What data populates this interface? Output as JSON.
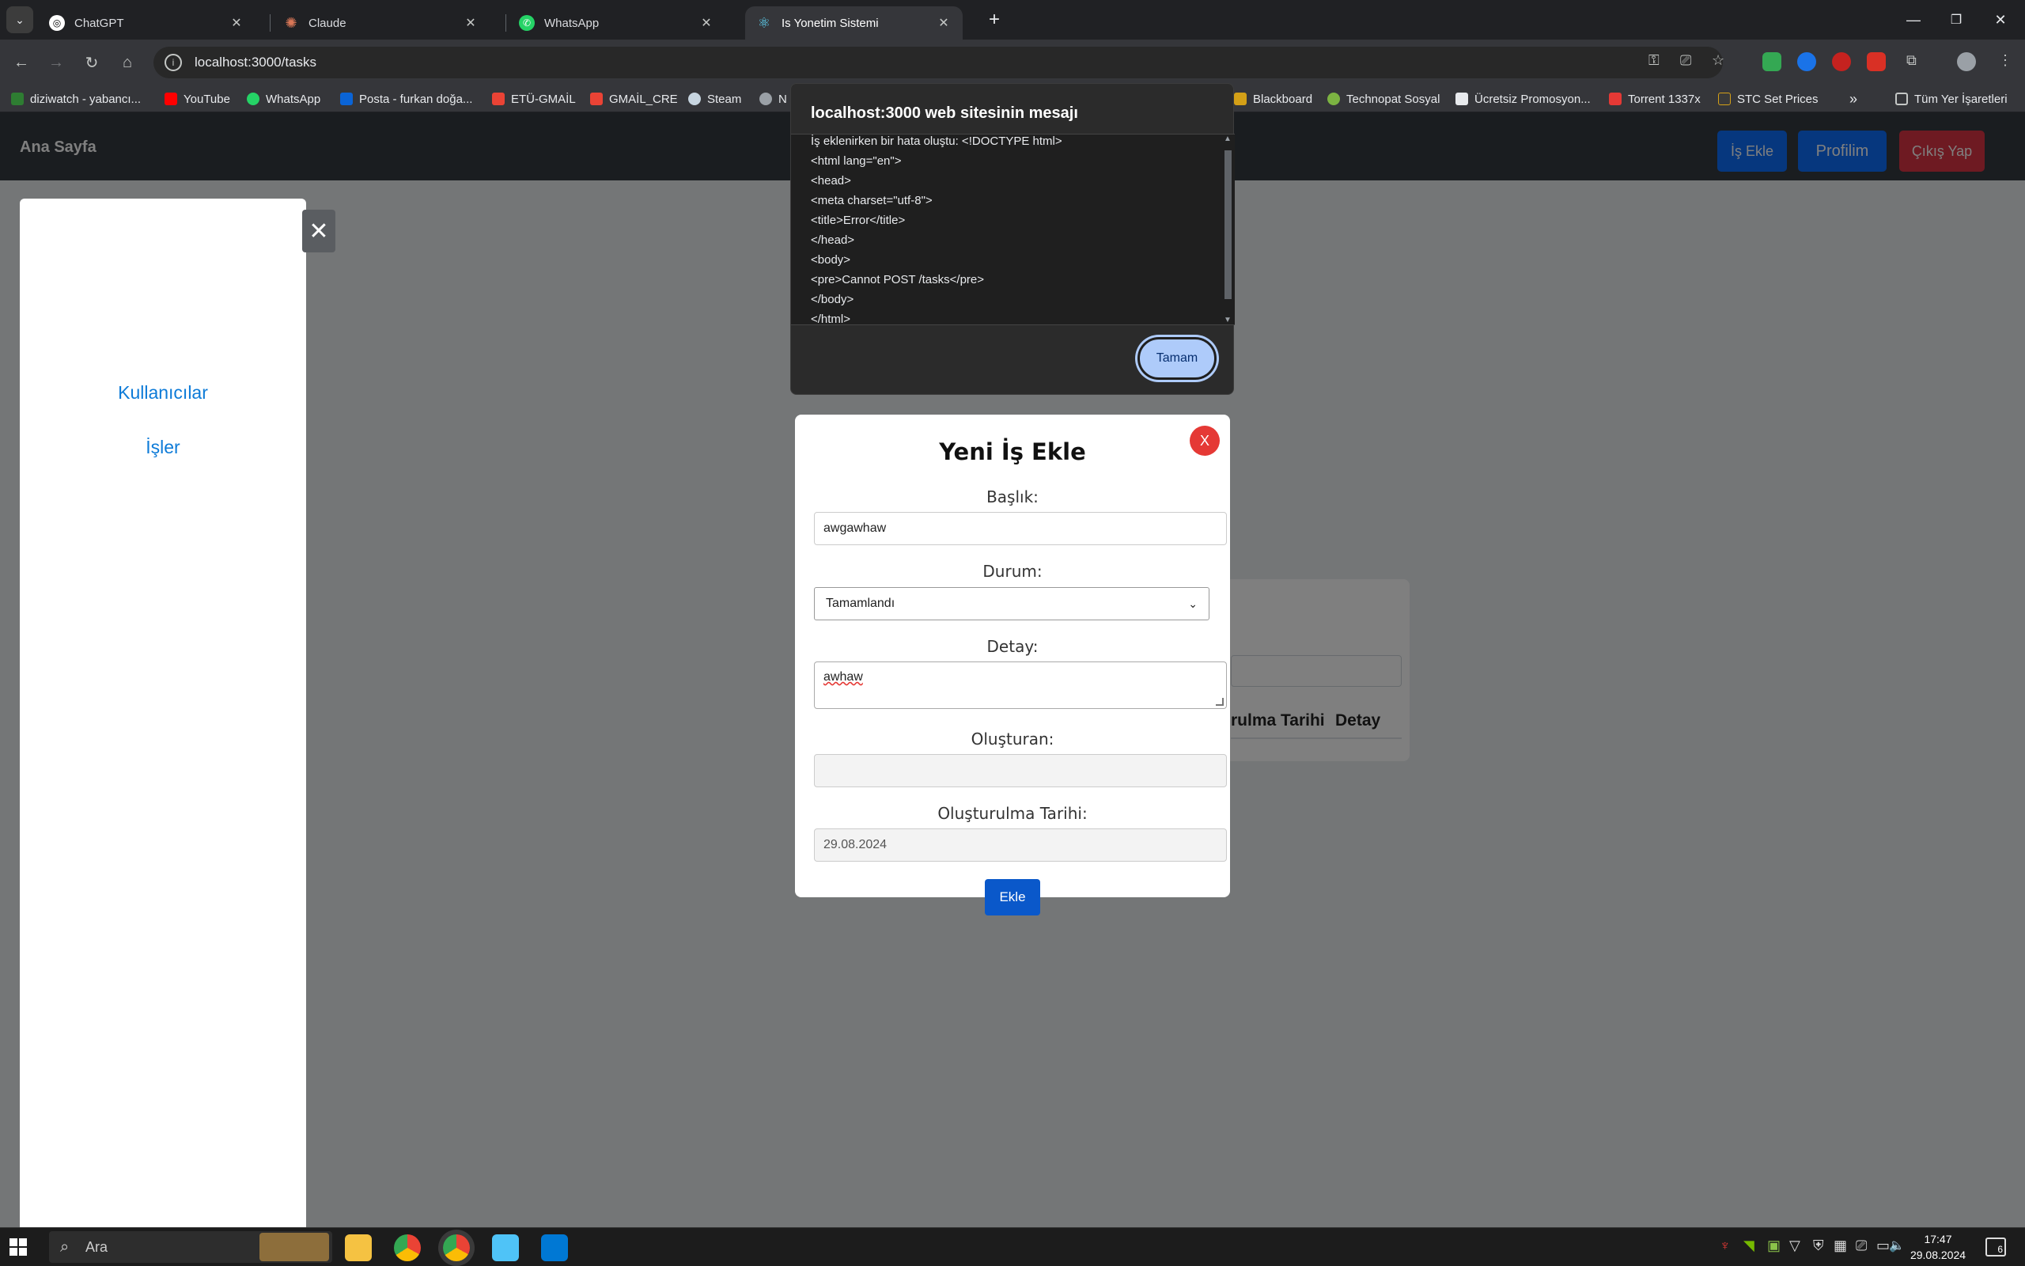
{
  "browser": {
    "tabs": [
      {
        "label": "ChatGPT",
        "icon": "chatgpt-icon",
        "color": "#ffffff"
      },
      {
        "label": "Claude",
        "icon": "claude-icon",
        "color": "#d97757"
      },
      {
        "label": "WhatsApp",
        "icon": "whatsapp-icon",
        "color": "#25d366"
      },
      {
        "label": "Is Yonetim Sistemi",
        "icon": "react-icon",
        "color": "#61dafb",
        "active": true
      }
    ],
    "new_tab": "+",
    "url": "localhost:3000/tasks",
    "bookmarks": [
      {
        "label": "diziwatch - yabancı...",
        "color": "#2e7d32"
      },
      {
        "label": "YouTube",
        "color": "#ff0000"
      },
      {
        "label": "WhatsApp",
        "color": "#25d366"
      },
      {
        "label": "Posta - furkan doğa...",
        "color": "#0a64d6"
      },
      {
        "label": "ETÜ-GMAİL",
        "color": "#ea4335"
      },
      {
        "label": "GMAİL_CRE",
        "color": "#ea4335"
      },
      {
        "label": "Steam",
        "color": "#1b2838"
      },
      {
        "label": "N",
        "color": "#9aa0a6"
      },
      {
        "label": "Blackboard",
        "color": "#d4a017"
      },
      {
        "label": "Technopat Sosyal",
        "color": "#7cb342"
      },
      {
        "label": "Ücretsiz Promosyon...",
        "color": "#e8eaed"
      },
      {
        "label": "Torrent 1337x",
        "color": "#e53935"
      },
      {
        "label": "STC Set Prices",
        "color": "#3a3a3a"
      }
    ],
    "all_bookmarks": "Tüm Yer İşaretleri"
  },
  "app": {
    "brand": "Ana Sayfa",
    "nav": {
      "add_task": "İş Ekle",
      "profile": "Profilim",
      "logout": "Çıkış Yap"
    },
    "sidebar": {
      "items": [
        "Kullanıcılar",
        "İşler"
      ]
    },
    "card": {
      "headers": [
        "rulma Tarihi",
        "Detay"
      ]
    }
  },
  "modal": {
    "title": "Yeni İş Ekle",
    "close": "X",
    "fields": {
      "title_label": "Başlık:",
      "title_value": "awgawhaw",
      "status_label": "Durum:",
      "status_value": "Tamamlandı",
      "detail_label": "Detay:",
      "detail_value": "awhaw",
      "creator_label": "Oluşturan:",
      "creator_value": "",
      "date_label": "Oluşturulma Tarihi:",
      "date_value": "29.08.2024"
    },
    "submit": "Ekle"
  },
  "alert": {
    "title": "localhost:3000 web sitesinin mesajı",
    "message": "İş eklenirken bir hata oluştu: <!DOCTYPE html>\n<html lang=\"en\">\n<head>\n<meta charset=\"utf-8\">\n<title>Error</title>\n</head>\n<body>\n<pre>Cannot POST /tasks</pre>\n</body>\n</html>",
    "ok": "Tamam"
  },
  "taskbar": {
    "search_placeholder": "Ara",
    "time": "17:47",
    "date": "29.08.2024",
    "notifications": "6"
  },
  "colors": {
    "primary": "#0a58ca",
    "danger": "#dc3545",
    "link": "#0d7bd8"
  }
}
